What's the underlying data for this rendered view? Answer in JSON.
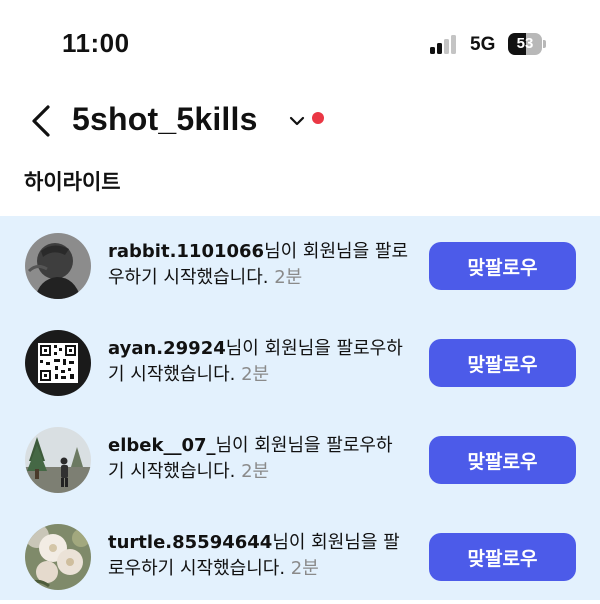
{
  "status_bar": {
    "time": "11:00",
    "network": "5G",
    "battery": "53",
    "battery_level": 0.53
  },
  "header": {
    "title": "5shot_5kills",
    "back_icon": "chevron-left-icon",
    "dropdown_icon": "chevron-down-icon"
  },
  "section": {
    "title": "하이라이트"
  },
  "notifications": [
    {
      "username": "rabbit.1101066",
      "message": "님이 회원님을 팔로우하기 시작했습니다.",
      "time": "2분",
      "button": "맞팔로우"
    },
    {
      "username": "ayan.29924",
      "message": "님이 회원님을 팔로우하기 시작했습니다.",
      "time": "2분",
      "button": "맞팔로우"
    },
    {
      "username": "elbek__07_",
      "message": "님이 회원님을 팔로우하기 시작했습니다.",
      "time": "2분",
      "button": "맞팔로우"
    },
    {
      "username": "turtle.85594644",
      "message": "님이 회원님을 팔로우하기 시작했습니다.",
      "time": "2분",
      "button": "맞팔로우"
    }
  ],
  "colors": {
    "highlight_background": "#e3f1fd",
    "button": "#4c5be9",
    "notification_dot": "#ea3744",
    "signal_active": "#111111",
    "signal_inactive": "#c4c4c4"
  }
}
